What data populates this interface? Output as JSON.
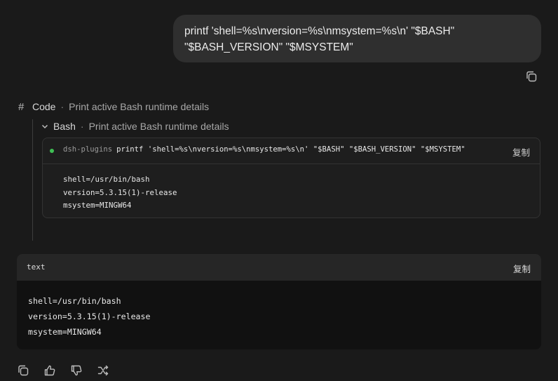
{
  "user_message": {
    "line1": "printf 'shell=%s\\nversion=%s\\nmsystem=%s\\n' \"$BASH\"",
    "line2": "\"$BASH_VERSION\" \"$MSYSTEM\""
  },
  "code_section": {
    "icon": "#",
    "label": "Code",
    "description": "Print active Bash runtime details"
  },
  "bash_step": {
    "label": "Bash",
    "description": "Print active Bash runtime details",
    "status_color": "#3fbf55"
  },
  "terminal": {
    "cwd": "dsh-plugins",
    "command": "printf 'shell=%s\\nversion=%s\\nmsystem=%s\\n' \"$BASH\" \"$BASH_VERSION\" \"$MSYSTEM\"",
    "copy_label": "复制",
    "output": [
      "shell=/usr/bin/bash",
      "version=5.3.15(1)-release",
      "msystem=MINGW64"
    ]
  },
  "text_block": {
    "language": "text",
    "copy_label": "复制",
    "lines": [
      "shell=/usr/bin/bash",
      "version=5.3.15(1)-release",
      "msystem=MINGW64"
    ]
  },
  "actions": [
    "copy-icon",
    "thumbs-up-icon",
    "thumbs-down-icon",
    "branch-icon"
  ]
}
